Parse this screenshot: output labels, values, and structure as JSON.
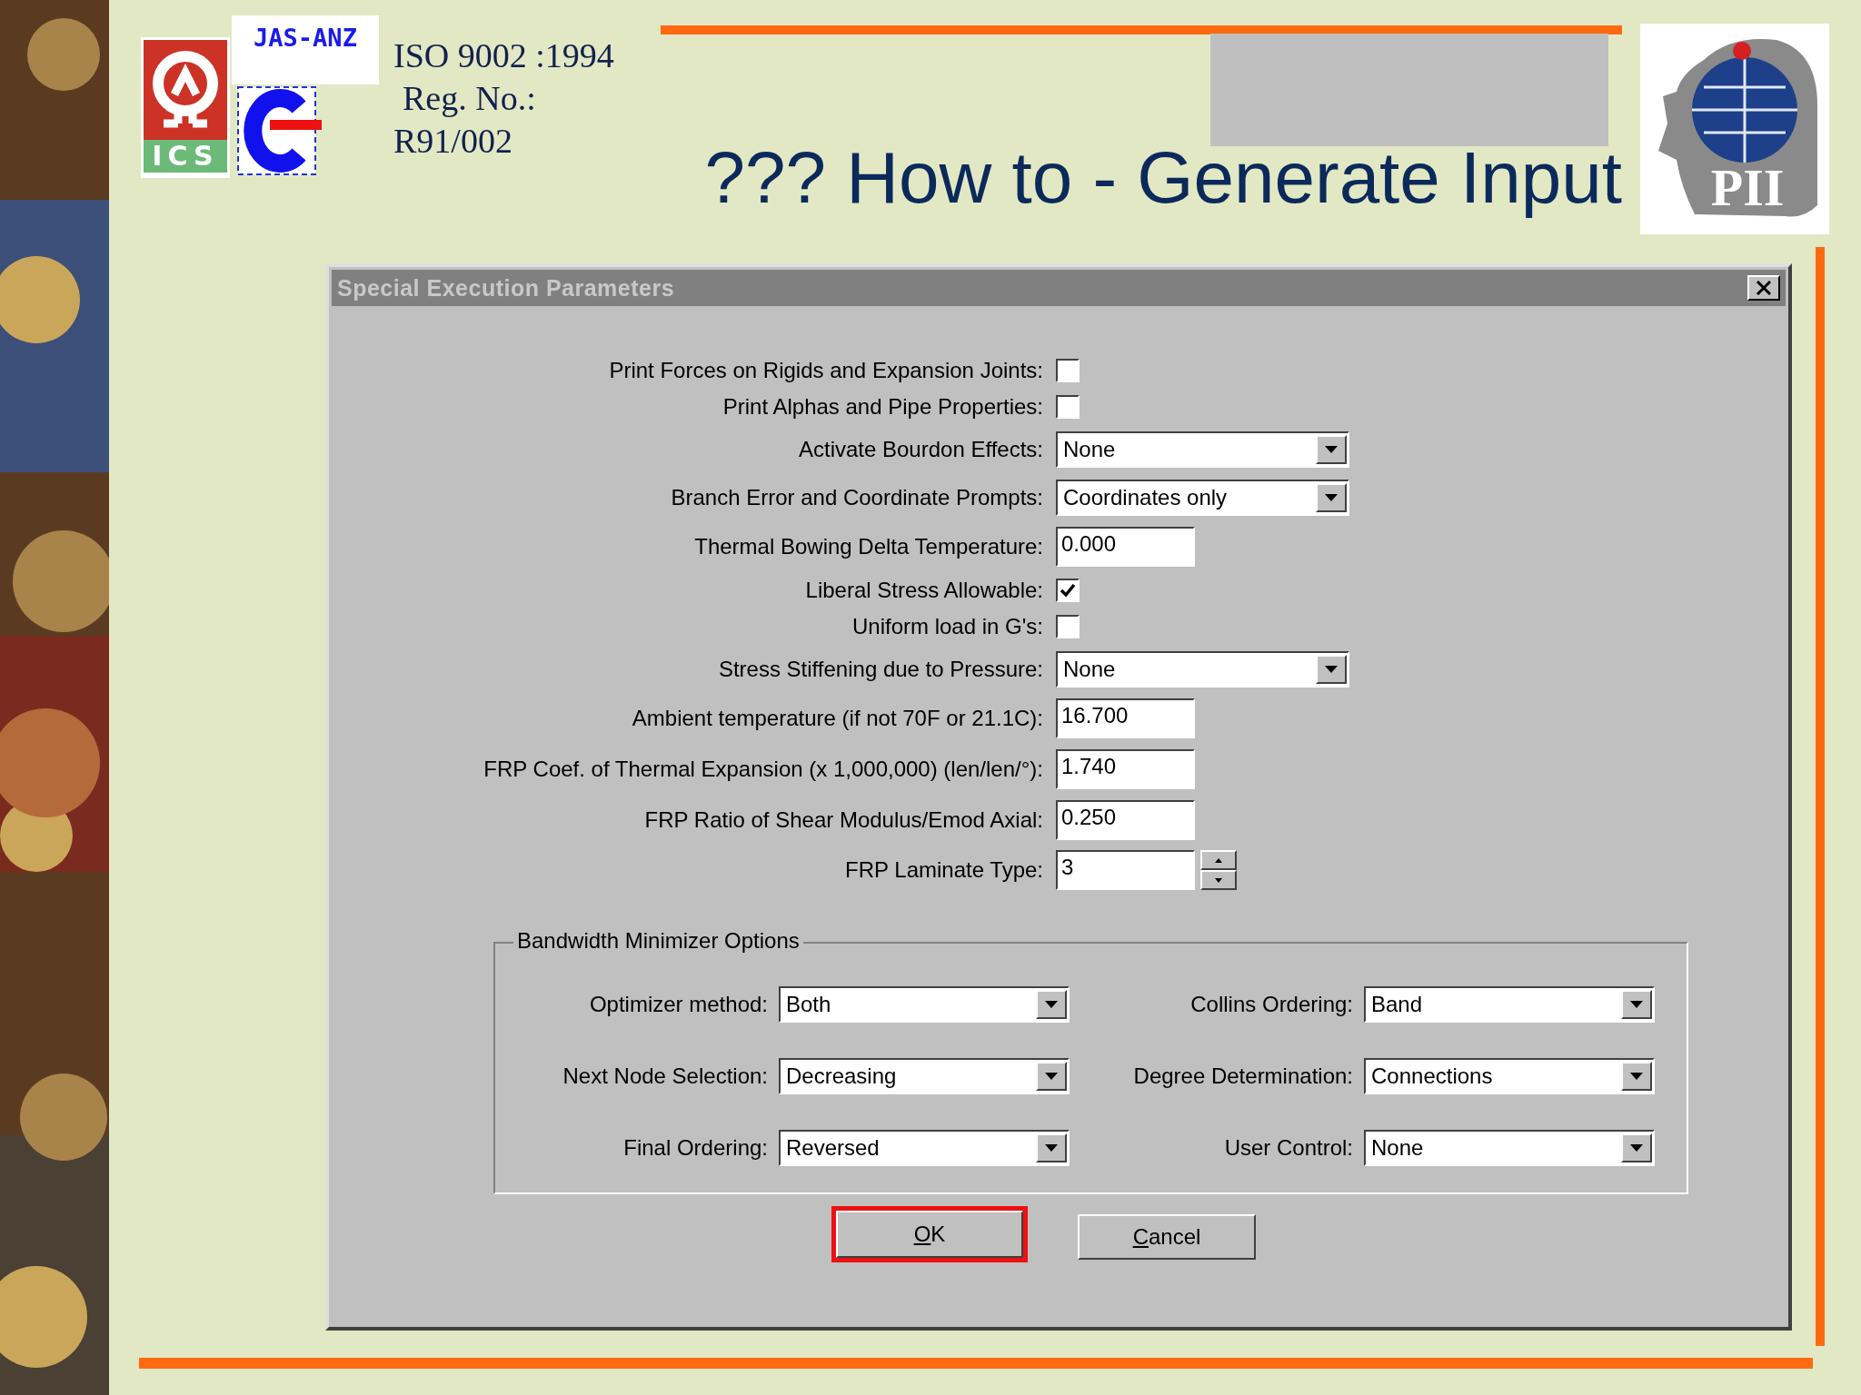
{
  "header": {
    "logo_badge": "JAS-ANZ",
    "logo_letters": "ICS",
    "certificate_lines": [
      "ISO 9002 :1994",
      "Reg. No.:",
      "R91/002"
    ],
    "title": "??? How to - Generate Input",
    "company_logo": "PII"
  },
  "dialog": {
    "title": "Special Execution Parameters",
    "fields": [
      {
        "kind": "checkbox",
        "label": "Print Forces on Rigids and Expansion Joints:",
        "checked": false
      },
      {
        "kind": "checkbox",
        "label": "Print Alphas and Pipe Properties:",
        "checked": false
      },
      {
        "kind": "combo",
        "label": "Activate Bourdon Effects:",
        "value": "None"
      },
      {
        "kind": "combo",
        "label": "Branch Error and Coordinate Prompts:",
        "value": "Coordinates only"
      },
      {
        "kind": "text",
        "label": "Thermal Bowing Delta Temperature:",
        "value": "0.000"
      },
      {
        "kind": "checkbox",
        "label": "Liberal Stress Allowable:",
        "checked": true
      },
      {
        "kind": "checkbox",
        "label": "Uniform load in G's:",
        "checked": false
      },
      {
        "kind": "combo",
        "label": "Stress Stiffening due to Pressure:",
        "value": "None"
      },
      {
        "kind": "text",
        "label": "Ambient temperature (if not 70F or 21.1C):",
        "value": "16.700"
      },
      {
        "kind": "text",
        "label": "FRP Coef. of Thermal Expansion (x 1,000,000) (len/len/°):",
        "value": "1.740"
      },
      {
        "kind": "text",
        "label": "FRP Ratio of Shear Modulus/Emod Axial:",
        "value": "0.250"
      },
      {
        "kind": "spin",
        "label": "FRP Laminate Type:",
        "value": "3"
      }
    ],
    "group": {
      "title": "Bandwidth Minimizer Options",
      "fields": [
        {
          "label": "Optimizer method:",
          "value": "Both"
        },
        {
          "label": "Collins Ordering:",
          "value": "Band"
        },
        {
          "label": "Next Node Selection:",
          "value": "Decreasing"
        },
        {
          "label": "Degree Determination:",
          "value": "Connections"
        },
        {
          "label": "Final Ordering:",
          "value": "Reversed"
        },
        {
          "label": "User Control:",
          "value": "None"
        }
      ]
    },
    "buttons": [
      {
        "label": "OK",
        "selected": true
      },
      {
        "label": "Cancel",
        "selected": false
      }
    ]
  }
}
